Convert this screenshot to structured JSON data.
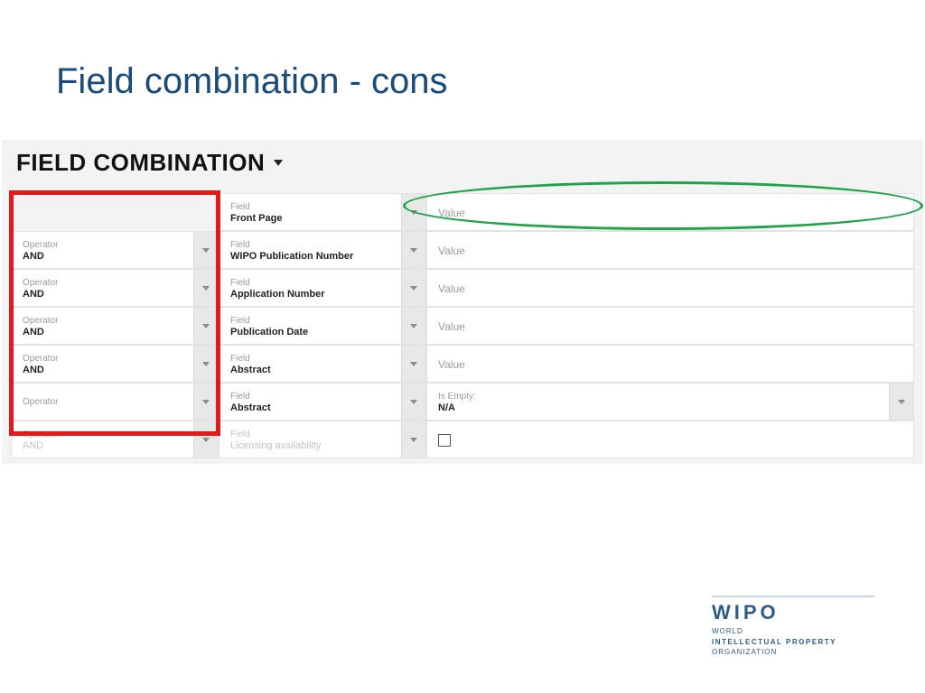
{
  "title": "Field combination - cons",
  "panel": {
    "heading": "FIELD COMBINATION",
    "rows": [
      {
        "operator_label": "",
        "operator_value": "",
        "show_op": false,
        "faded": false,
        "field_label": "Field",
        "field_value": "Front Page",
        "value_label": "Value",
        "value_text": "",
        "dropdown_value": false,
        "checkbox": false
      },
      {
        "operator_label": "Operator",
        "operator_value": "AND",
        "show_op": true,
        "faded": false,
        "field_label": "Field",
        "field_value": "WIPO Publication Number",
        "value_label": "Value",
        "value_text": "",
        "dropdown_value": false,
        "checkbox": false
      },
      {
        "operator_label": "Operator",
        "operator_value": "AND",
        "show_op": true,
        "faded": false,
        "field_label": "Field",
        "field_value": "Application Number",
        "value_label": "Value",
        "value_text": "",
        "dropdown_value": false,
        "checkbox": false
      },
      {
        "operator_label": "Operator",
        "operator_value": "AND",
        "show_op": true,
        "faded": false,
        "field_label": "Field",
        "field_value": "Publication Date",
        "value_label": "Value",
        "value_text": "",
        "dropdown_value": false,
        "checkbox": false
      },
      {
        "operator_label": "Operator",
        "operator_value": "AND",
        "show_op": true,
        "faded": false,
        "field_label": "Field",
        "field_value": "Abstract",
        "value_label": "Value",
        "value_text": "",
        "dropdown_value": false,
        "checkbox": false
      },
      {
        "operator_label": "Operator",
        "operator_value": "",
        "show_op": true,
        "faded": false,
        "field_label": "Field",
        "field_value": "Abstract",
        "value_label": "Is Empty:",
        "value_text": "N/A",
        "dropdown_value": true,
        "checkbox": false
      },
      {
        "operator_label": "Operator",
        "operator_value": "AND",
        "show_op": true,
        "faded": true,
        "field_label": "Field",
        "field_value": "Licensing availability",
        "value_label": "",
        "value_text": "",
        "dropdown_value": false,
        "checkbox": true
      }
    ]
  },
  "logo": {
    "name": "WIPO",
    "line1": "WORLD",
    "line2": "INTELLECTUAL PROPERTY",
    "line3": "ORGANIZATION"
  }
}
